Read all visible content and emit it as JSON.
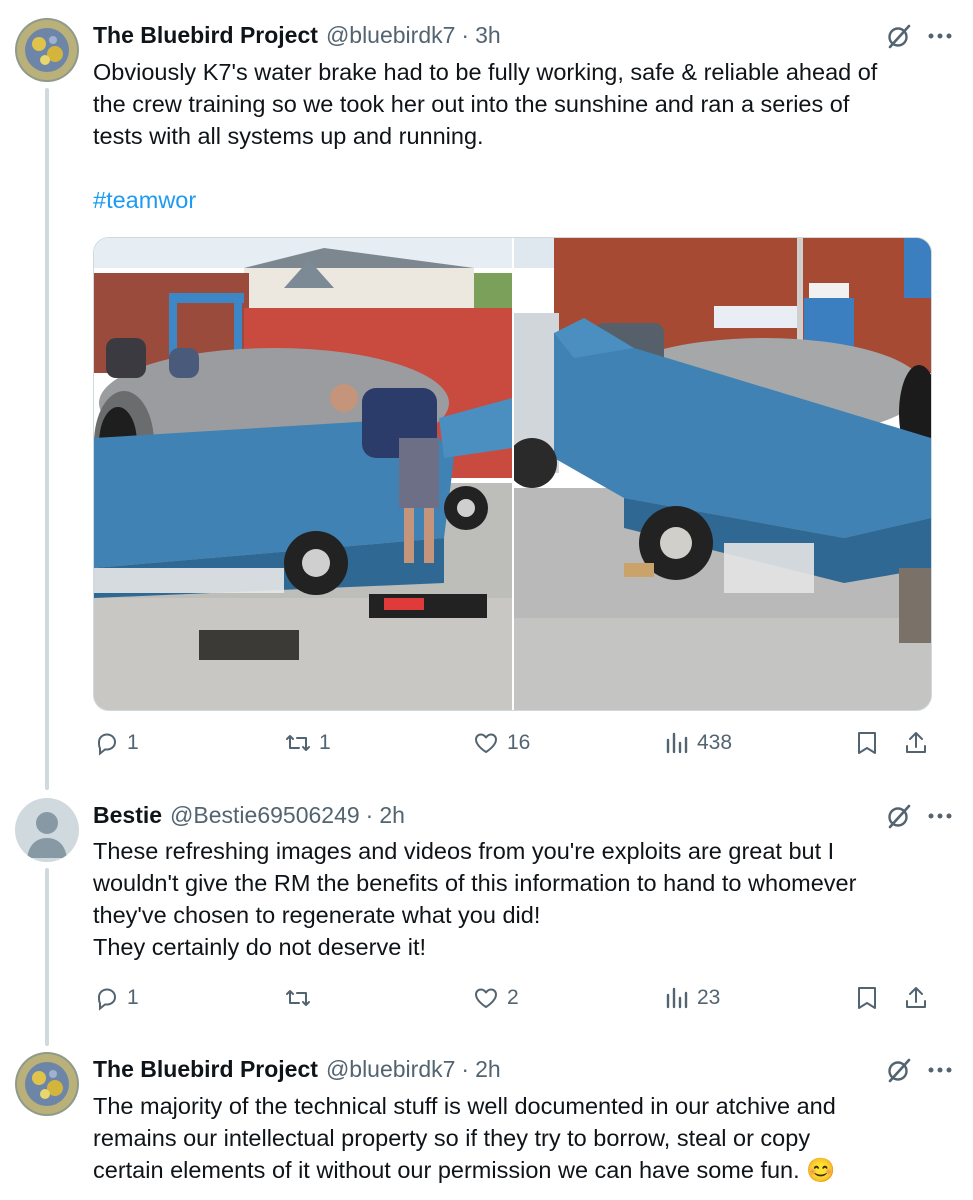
{
  "tweets": [
    {
      "display_name": "The Bluebird Project",
      "handle": "@bluebirdk7",
      "separator": "·",
      "time": "3h",
      "text_lines": [
        "Obviously K7's water brake had to be fully working, safe & reliable ahead of",
        "the crew training so we took her out into the sunshine and ran a series of",
        "tests with all systems up and running."
      ],
      "hashtag": "#teamwor",
      "stats": {
        "replies": "1",
        "reposts": "1",
        "likes": "16",
        "views": "438"
      }
    },
    {
      "display_name": "Bestie",
      "handle": "@Bestie69506249",
      "separator": "·",
      "time": "2h",
      "text_lines": [
        "These refreshing images and videos from you're exploits are great but I",
        "wouldn't give the RM the benefits of this information to hand to whomever",
        "they've chosen to regenerate what you did!",
        "They certainly do not deserve it!"
      ],
      "stats": {
        "replies": "1",
        "reposts": "",
        "likes": "2",
        "views": "23"
      }
    },
    {
      "display_name": "The Bluebird Project",
      "handle": "@bluebirdk7",
      "separator": "·",
      "time": "2h",
      "text_lines": [
        "The majority of the technical stuff is well documented in our atchive and",
        "remains our intellectual property so if they try to borrow, steal or copy",
        "certain elements of it without our permission we can have some fun. 😊"
      ]
    }
  ],
  "icons": [
    "grok-icon",
    "more-icon",
    "reply-icon",
    "repost-icon",
    "like-icon",
    "views-icon",
    "bookmark-icon",
    "share-icon"
  ],
  "colors": {
    "text": "#0f1419",
    "secondary": "#536471",
    "link": "#1d9bf0",
    "thread_line": "#cfd9de",
    "boat_blue": "#3f82b3"
  }
}
